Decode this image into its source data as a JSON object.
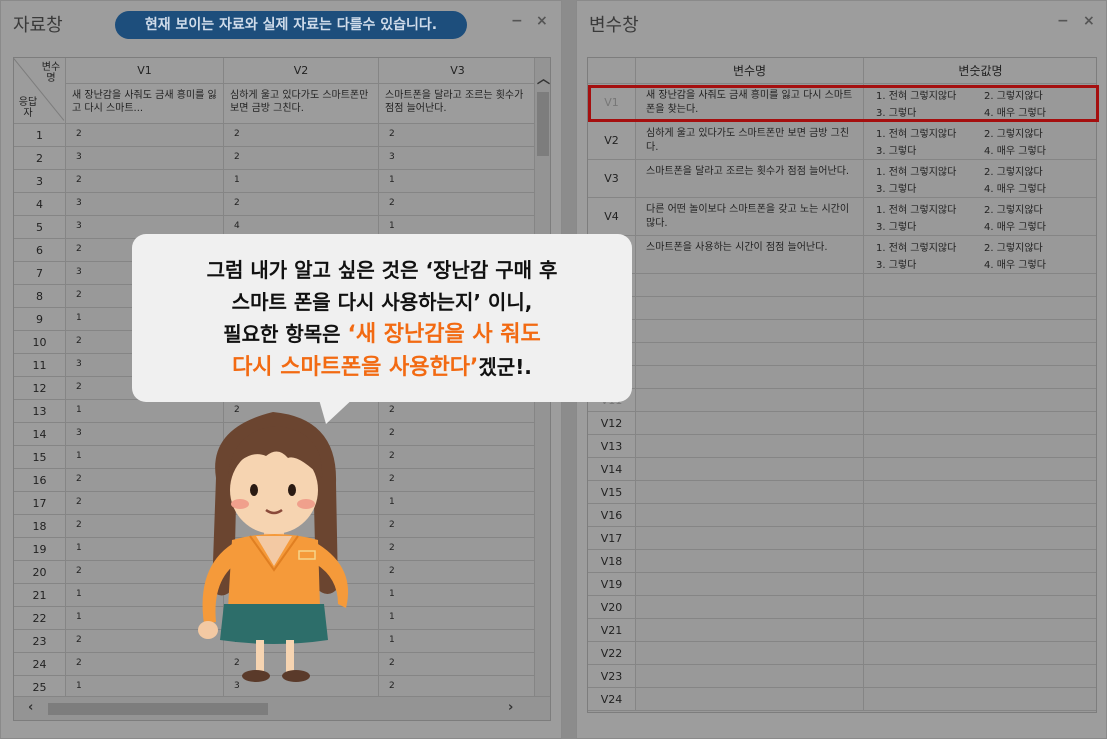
{
  "data_window": {
    "title": "자료창",
    "notice": "현재 보이는 자료와 실제 자료는 다를수 있습니다.",
    "minimize": "−",
    "close": "×",
    "corner_top": "변수명",
    "corner_bottom": "응답자",
    "columns": [
      {
        "name": "V1",
        "label": "새 장난감을 사줘도 금새 흥미를 잃고 다시 스마트..."
      },
      {
        "name": "V2",
        "label": "심하게 울고 있다가도 스마트폰만 보면 금방 그친다."
      },
      {
        "name": "V3",
        "label": "스마트폰을 달라고 조르는 횟수가 점점 늘어난다."
      }
    ],
    "rows": [
      {
        "n": "1",
        "v": [
          "2",
          "2",
          "2"
        ]
      },
      {
        "n": "2",
        "v": [
          "3",
          "2",
          "3"
        ]
      },
      {
        "n": "3",
        "v": [
          "2",
          "1",
          "1"
        ]
      },
      {
        "n": "4",
        "v": [
          "3",
          "2",
          "2"
        ]
      },
      {
        "n": "5",
        "v": [
          "3",
          "4",
          "1"
        ]
      },
      {
        "n": "6",
        "v": [
          "2",
          "1",
          ""
        ]
      },
      {
        "n": "7",
        "v": [
          "3",
          "",
          ""
        ]
      },
      {
        "n": "8",
        "v": [
          "2",
          "",
          ""
        ]
      },
      {
        "n": "9",
        "v": [
          "1",
          "",
          ""
        ]
      },
      {
        "n": "10",
        "v": [
          "2",
          "",
          ""
        ]
      },
      {
        "n": "11",
        "v": [
          "3",
          "",
          ""
        ]
      },
      {
        "n": "12",
        "v": [
          "2",
          "",
          ""
        ]
      },
      {
        "n": "13",
        "v": [
          "1",
          "2",
          "2"
        ]
      },
      {
        "n": "14",
        "v": [
          "3",
          "",
          "2"
        ]
      },
      {
        "n": "15",
        "v": [
          "1",
          "",
          "2"
        ]
      },
      {
        "n": "16",
        "v": [
          "2",
          "",
          "2"
        ]
      },
      {
        "n": "17",
        "v": [
          "2",
          "",
          "1"
        ]
      },
      {
        "n": "18",
        "v": [
          "2",
          "",
          "2"
        ]
      },
      {
        "n": "19",
        "v": [
          "1",
          "",
          "2"
        ]
      },
      {
        "n": "20",
        "v": [
          "2",
          "",
          "2"
        ]
      },
      {
        "n": "21",
        "v": [
          "1",
          "",
          "1"
        ]
      },
      {
        "n": "22",
        "v": [
          "1",
          "",
          "1"
        ]
      },
      {
        "n": "23",
        "v": [
          "2",
          "1",
          "1"
        ]
      },
      {
        "n": "24",
        "v": [
          "2",
          "2",
          "2"
        ]
      },
      {
        "n": "25",
        "v": [
          "1",
          "3",
          "2"
        ]
      }
    ]
  },
  "var_window": {
    "title": "변수창",
    "minimize": "−",
    "close": "×",
    "header_name": "변수명",
    "header_values": "변숫값명",
    "variables": [
      {
        "id": "V1",
        "label": "새 장난감을 사줘도 금새 흥미를 잃고 다시 스마트폰을 찾는다.",
        "values": [
          "1. 전혀 그렇지않다",
          "2. 그렇지않다",
          "3. 그렇다",
          "4. 매우 그렇다"
        ]
      },
      {
        "id": "V2",
        "label": "심하게 울고 있다가도 스마트폰만 보면 금방 그친다.",
        "values": [
          "1. 전혀 그렇지않다",
          "2. 그렇지않다",
          "3. 그렇다",
          "4. 매우 그렇다"
        ]
      },
      {
        "id": "V3",
        "label": "스마트폰을 달라고 조르는 횟수가 점점 늘어난다.",
        "values": [
          "1. 전혀 그렇지않다",
          "2. 그렇지않다",
          "3. 그렇다",
          "4. 매우 그렇다"
        ]
      },
      {
        "id": "V4",
        "label": "다른 어떤 놀이보다 스마트폰을 갖고 노는 시간이 많다.",
        "values": [
          "1. 전혀 그렇지않다",
          "2. 그렇지않다",
          "3. 그렇다",
          "4. 매우 그렇다"
        ]
      },
      {
        "id": "V5",
        "label": "스마트폰을 사용하는 시간이 점점 늘어난다.",
        "values": [
          "1. 전혀 그렇지않다",
          "2. 그렇지않다",
          "3. 그렇다",
          "4. 매우 그렇다"
        ]
      },
      {
        "id": "V6",
        "label": "",
        "values": []
      },
      {
        "id": "V7",
        "label": "",
        "values": []
      },
      {
        "id": "V8",
        "label": "",
        "values": []
      },
      {
        "id": "V9",
        "label": "",
        "values": []
      },
      {
        "id": "V10",
        "label": "",
        "values": []
      },
      {
        "id": "V11",
        "label": "",
        "values": []
      },
      {
        "id": "V12",
        "label": "",
        "values": []
      },
      {
        "id": "V13",
        "label": "",
        "values": []
      },
      {
        "id": "V14",
        "label": "",
        "values": []
      },
      {
        "id": "V15",
        "label": "",
        "values": []
      },
      {
        "id": "V16",
        "label": "",
        "values": []
      },
      {
        "id": "V17",
        "label": "",
        "values": []
      },
      {
        "id": "V18",
        "label": "",
        "values": []
      },
      {
        "id": "V19",
        "label": "",
        "values": []
      },
      {
        "id": "V20",
        "label": "",
        "values": []
      },
      {
        "id": "V21",
        "label": "",
        "values": []
      },
      {
        "id": "V22",
        "label": "",
        "values": []
      },
      {
        "id": "V23",
        "label": "",
        "values": []
      },
      {
        "id": "V24",
        "label": "",
        "values": []
      }
    ]
  },
  "bubble": {
    "line1": "그럼 내가 알고 싶은 것은 ‘장난감 구매 후",
    "line2": "스마트 폰을 다시 사용하는지’ 이니,",
    "line3_plain": "필요한 항목은 ",
    "line3_orange": "‘새 장난감을 사 줘도",
    "line4_orange": "다시 스마트폰을 사용한다’",
    "line4_plain": "겠군!."
  }
}
